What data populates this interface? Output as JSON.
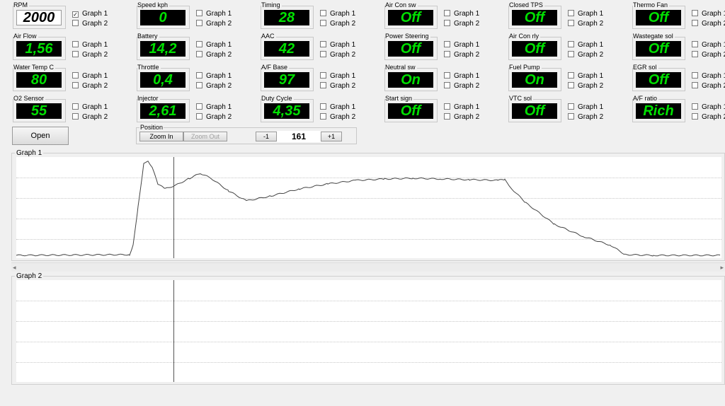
{
  "gauges": [
    {
      "label": "RPM",
      "value": "2000",
      "style": "white",
      "g1": true,
      "g2": false
    },
    {
      "label": "Air Flow",
      "value": "1,56",
      "g1": false,
      "g2": false
    },
    {
      "label": "Water Temp C",
      "value": "80",
      "g1": false,
      "g2": false
    },
    {
      "label": "O2 Sensor",
      "value": "55",
      "g1": false,
      "g2": false
    },
    {
      "label": "Speed kph",
      "value": "0",
      "g1": false,
      "g2": false
    },
    {
      "label": "Battery",
      "value": "14,2",
      "g1": false,
      "g2": false
    },
    {
      "label": "Throttle",
      "value": "0,4",
      "g1": false,
      "g2": false
    },
    {
      "label": "Injector",
      "value": "2,61",
      "g1": false,
      "g2": false
    },
    {
      "label": "Timing",
      "value": "28",
      "g1": false,
      "g2": false
    },
    {
      "label": "AAC",
      "value": "42",
      "g1": false,
      "g2": false
    },
    {
      "label": "A/F Base",
      "value": "97",
      "g1": false,
      "g2": false
    },
    {
      "label": "Duty Cycle",
      "value": "4,35",
      "g1": false,
      "g2": false
    },
    {
      "label": "Air Con sw",
      "value": "Off",
      "g1": false,
      "g2": false
    },
    {
      "label": "Power Steering",
      "value": "Off",
      "g1": false,
      "g2": false
    },
    {
      "label": "Neutral sw",
      "value": "On",
      "g1": false,
      "g2": false
    },
    {
      "label": "Start sign",
      "value": "Off",
      "g1": false,
      "g2": false
    },
    {
      "label": "Closed TPS",
      "value": "Off",
      "g1": false,
      "g2": false
    },
    {
      "label": "Air Con rly",
      "value": "Off",
      "g1": false,
      "g2": false
    },
    {
      "label": "Fuel Pump",
      "value": "On",
      "g1": false,
      "g2": false
    },
    {
      "label": "VTC sol",
      "value": "Off",
      "g1": false,
      "g2": false
    },
    {
      "label": "Thermo Fan",
      "value": "Off",
      "g1": false,
      "g2": false
    },
    {
      "label": "Wastegate sol",
      "value": "Off",
      "g1": false,
      "g2": false
    },
    {
      "label": "EGR sol",
      "value": "Off",
      "g1": false,
      "g2": false
    },
    {
      "label": "A/F ratio",
      "value": "Rich",
      "g1": false,
      "g2": false
    }
  ],
  "checkbox_labels": {
    "graph1": "Graph 1",
    "graph2": "Graph 2"
  },
  "open_button": "Open",
  "position": {
    "title": "Position",
    "zoom_in": "Zoom In",
    "zoom_out": "Zoom Out",
    "minus": "-1",
    "plus": "+1",
    "value": "161"
  },
  "graphs": {
    "graph1_title": "Graph 1",
    "graph2_title": "Graph 2"
  },
  "scroll": {
    "left_arrow": "◂",
    "right_arrow": "▸"
  },
  "colors": {
    "display_bg": "#000000",
    "display_fg": "#00e000"
  }
}
